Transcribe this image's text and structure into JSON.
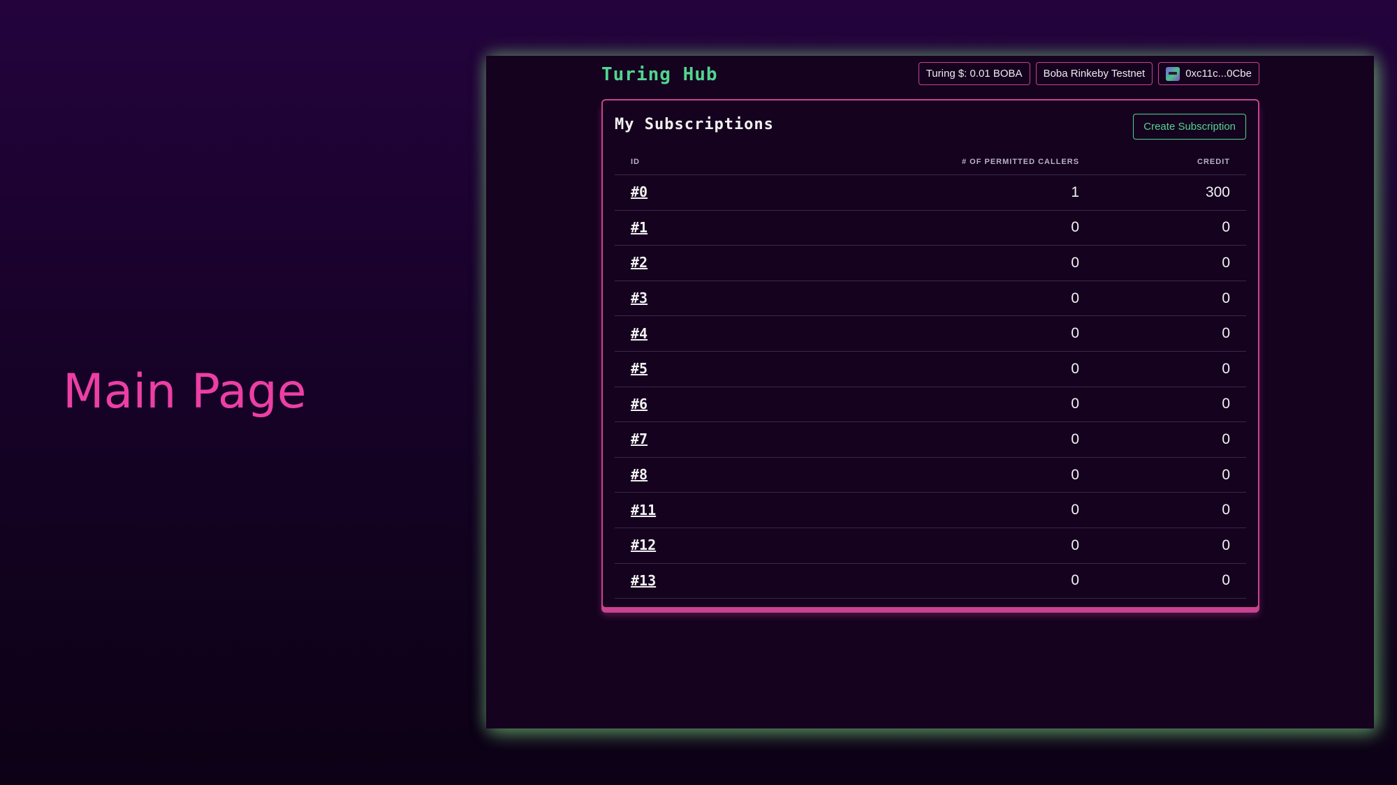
{
  "slide": {
    "title": "Main Page"
  },
  "app": {
    "brand": "Turing Hub",
    "balance_label": "Turing $: 0.01 BOBA",
    "network_label": "Boba Rinkeby Testnet",
    "account_label": "0xc11c...0Cbe"
  },
  "subscriptions": {
    "title": "My Subscriptions",
    "create_label": "Create Subscription",
    "columns": {
      "id": "ID",
      "callers": "# OF PERMITTED CALLERS",
      "credit": "CREDIT"
    },
    "rows": [
      {
        "id": "#0",
        "callers": "1",
        "credit": "300"
      },
      {
        "id": "#1",
        "callers": "0",
        "credit": "0"
      },
      {
        "id": "#2",
        "callers": "0",
        "credit": "0"
      },
      {
        "id": "#3",
        "callers": "0",
        "credit": "0"
      },
      {
        "id": "#4",
        "callers": "0",
        "credit": "0"
      },
      {
        "id": "#5",
        "callers": "0",
        "credit": "0"
      },
      {
        "id": "#6",
        "callers": "0",
        "credit": "0"
      },
      {
        "id": "#7",
        "callers": "0",
        "credit": "0"
      },
      {
        "id": "#8",
        "callers": "0",
        "credit": "0"
      },
      {
        "id": "#11",
        "callers": "0",
        "credit": "0"
      },
      {
        "id": "#12",
        "callers": "0",
        "credit": "0"
      },
      {
        "id": "#13",
        "callers": "0",
        "credit": "0"
      }
    ]
  },
  "colors": {
    "accent_pink": "#ec3fa4",
    "brand_green": "#52d58f",
    "border_pink": "#c7428f"
  },
  "icons": {
    "account_avatar": "avatar-icon"
  }
}
